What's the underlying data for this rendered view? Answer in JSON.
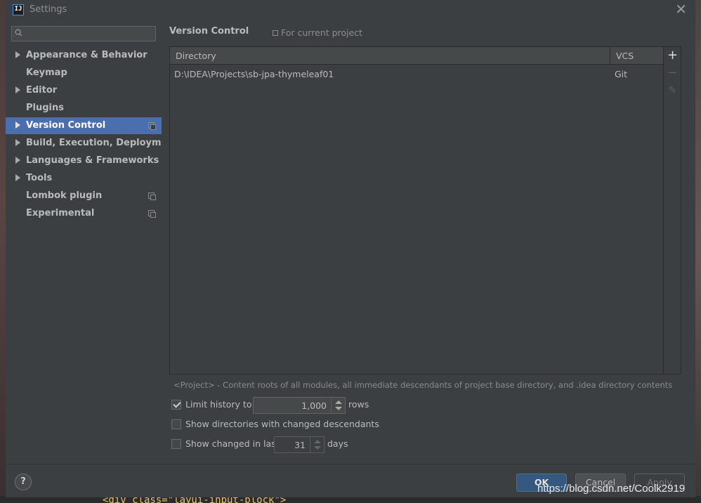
{
  "window": {
    "title": "Settings",
    "app_icon_text": "IJ"
  },
  "sidebar": {
    "search": {
      "placeholder": "",
      "value": ""
    },
    "items": [
      {
        "label": "Appearance & Behavior",
        "expandable": true,
        "project": false
      },
      {
        "label": "Keymap",
        "expandable": false,
        "project": false
      },
      {
        "label": "Editor",
        "expandable": true,
        "project": false
      },
      {
        "label": "Plugins",
        "expandable": false,
        "project": false
      },
      {
        "label": "Version Control",
        "expandable": true,
        "project": true,
        "selected": true
      },
      {
        "label": "Build, Execution, Deployment",
        "expandable": true,
        "project": false
      },
      {
        "label": "Languages & Frameworks",
        "expandable": true,
        "project": false
      },
      {
        "label": "Tools",
        "expandable": true,
        "project": false
      },
      {
        "label": "Lombok plugin",
        "expandable": false,
        "project": true
      },
      {
        "label": "Experimental",
        "expandable": false,
        "project": true
      }
    ]
  },
  "content": {
    "title": "Version Control",
    "scope": "For current project",
    "table": {
      "headers": {
        "directory": "Directory",
        "vcs": "VCS"
      },
      "rows": [
        {
          "directory": "D:\\IDEA\\Projects\\sb-jpa-thymeleaf01",
          "vcs": "Git"
        }
      ]
    },
    "toolbar": {
      "add": "+",
      "remove": "−",
      "edit": "✎"
    },
    "hint": "<Project> - Content roots of all modules, all immediate descendants of project base directory, and .idea directory contents",
    "options": {
      "limit_history": {
        "label": "Limit history to:",
        "checked": true,
        "value": "1,000",
        "suffix": "rows"
      },
      "show_dirs": {
        "label": "Show directories with changed descendants",
        "checked": false
      },
      "show_changed": {
        "label": "Show changed in last",
        "checked": false,
        "value": "31",
        "suffix": "days"
      }
    }
  },
  "footer": {
    "help": "?",
    "ok": "OK",
    "cancel": "Cancel",
    "apply": "Apply"
  },
  "watermark": "https://blog.csdn.net/Coolk2919",
  "backdrop_code": "<div class=\"layui-input-block\">",
  "colors": {
    "background": "#3c3f41",
    "selection": "#4b6eaf",
    "ok_button": "#365880"
  }
}
